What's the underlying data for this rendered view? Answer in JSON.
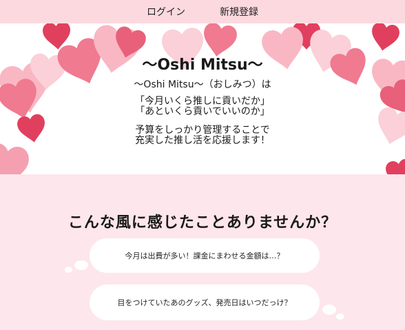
{
  "nav": {
    "login_label": "ログイン",
    "signup_label": "新規登録"
  },
  "hero": {
    "title": "〜Oshi Mitsu〜",
    "lead": "〜Oshi Mitsu〜（おしみつ）は",
    "quote_line1": "「今月いくら推しに貢いだか」",
    "quote_line2": "「あといくら貢いでいいのか」",
    "desc_line1": "予算をしっかり管理することで",
    "desc_line2": "充実した推し活を応援します！",
    "colors": {
      "heart_dark": "#e0405e",
      "heart_mid": "#f07a90",
      "heart_light": "#f9b7c4"
    }
  },
  "problems": {
    "heading": "こんな風に感じたことありませんか？",
    "bubbles": [
      "今月は出費が多い！課金にまわせる金額は…？",
      "目をつけていたあのグッズ、発売日はいつだっけ？"
    ]
  }
}
